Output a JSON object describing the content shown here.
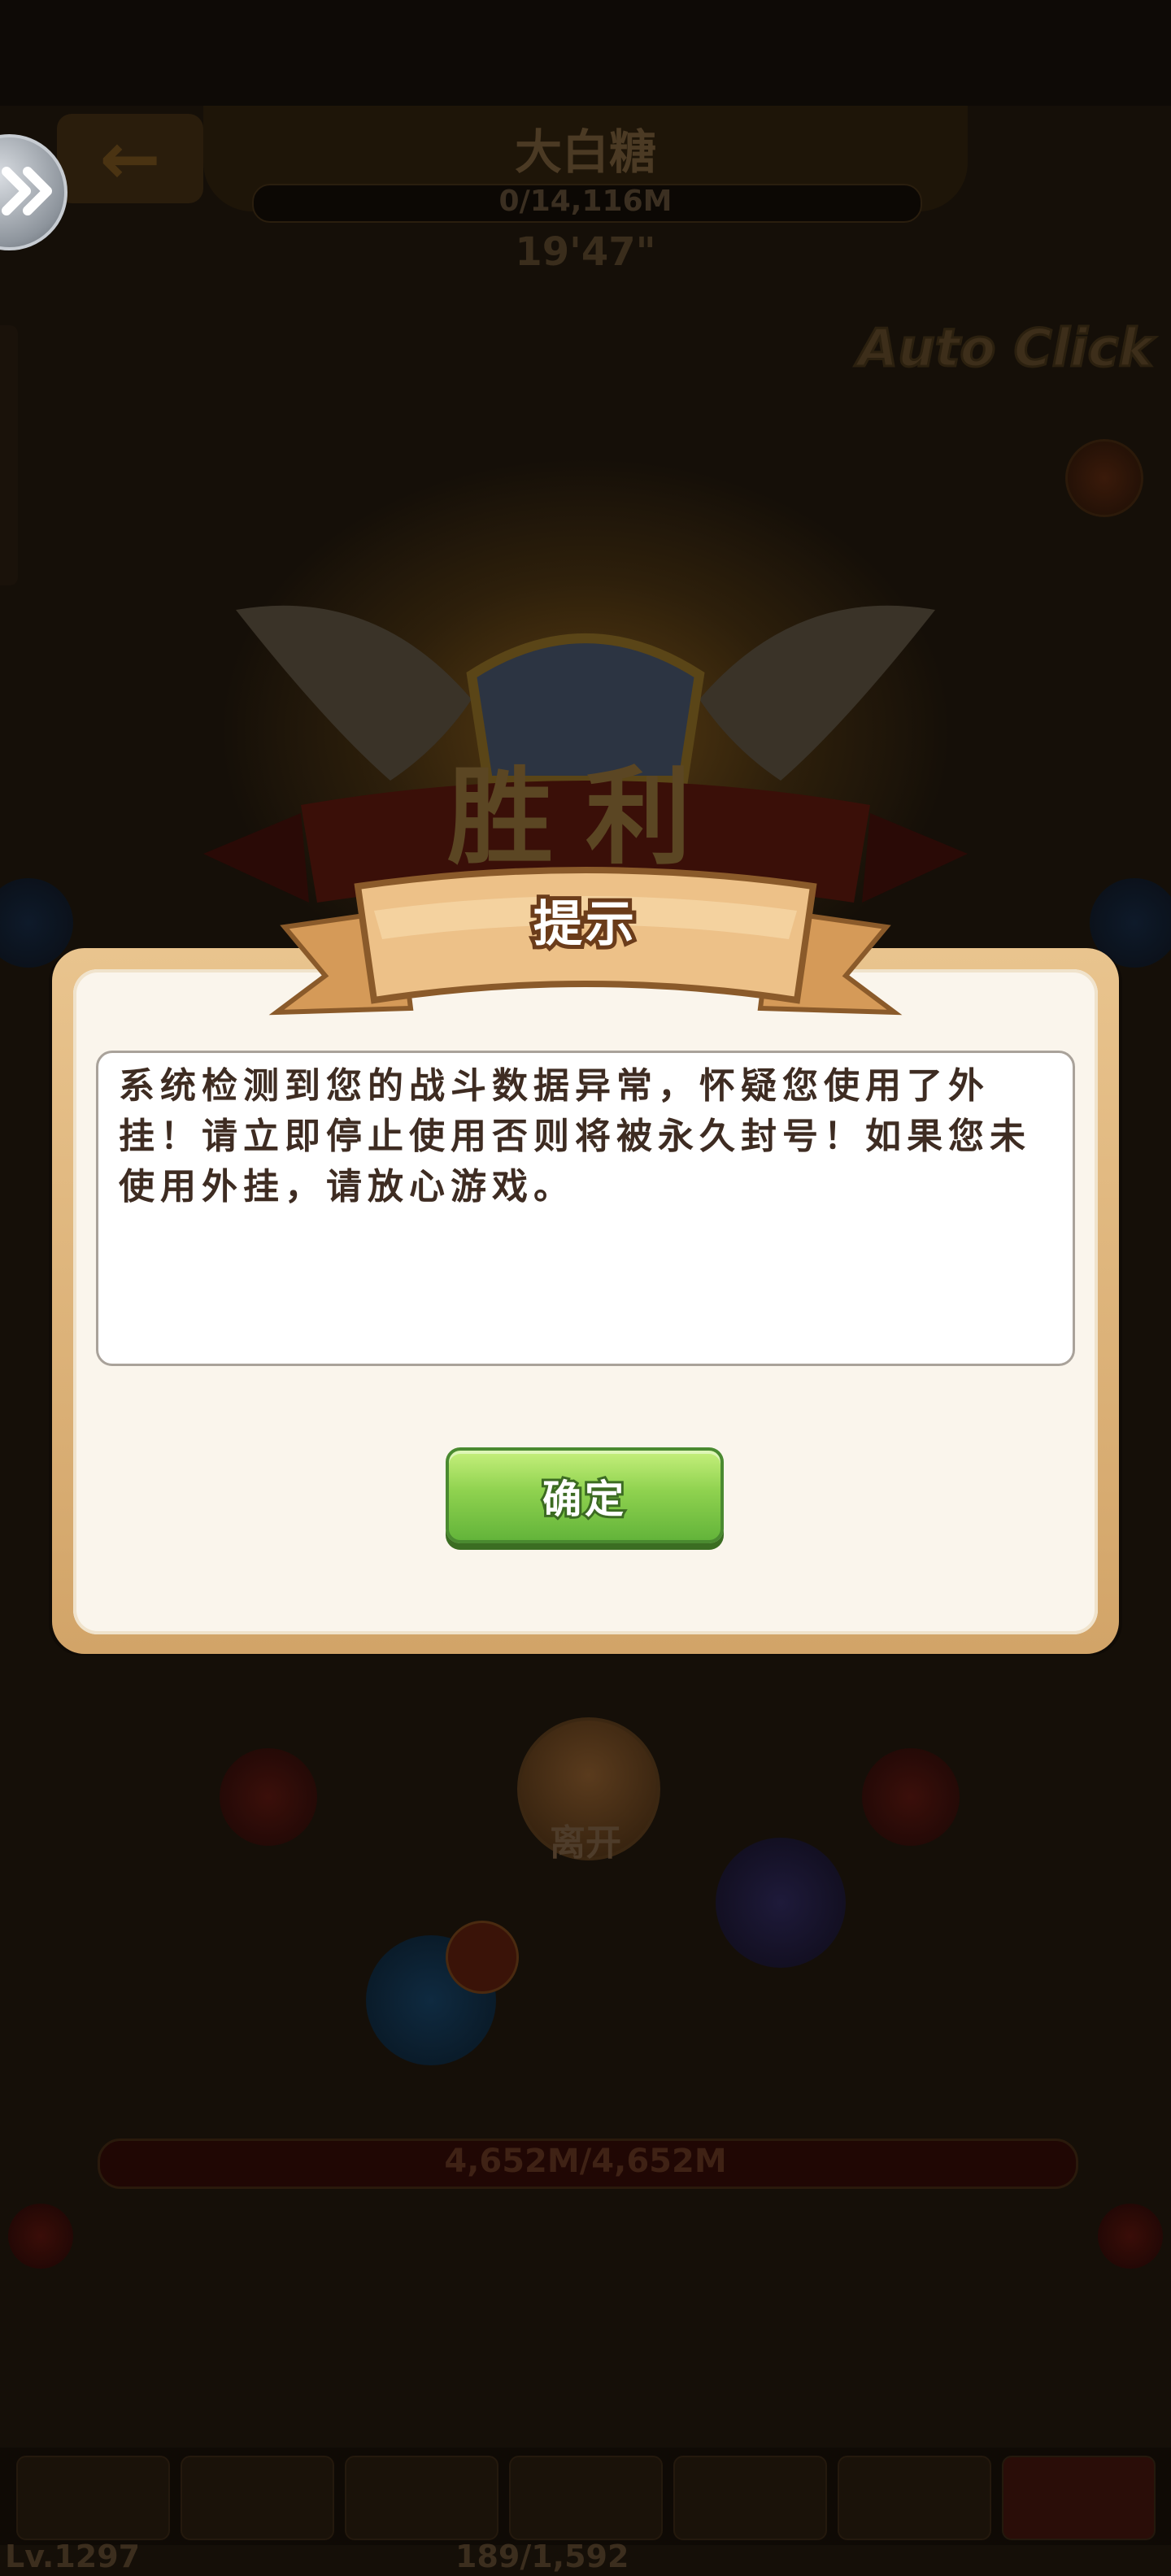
{
  "scene": {
    "stage_title": "大白糖",
    "hp_progress_text": "0/14,116M",
    "timer": "19'47\"",
    "auto_click": "Auto Click",
    "victory_text": "胜利",
    "leave_label": "离开",
    "bottom_hp_text": "4,652M/4,652M",
    "level_text": "Lv.1297",
    "energy_text": "189/1,592"
  },
  "dialog": {
    "title": "提示",
    "message": "系统检测到您的战斗数据异常，怀疑您使用了外挂！请立即停止使用否则将被永久封号！如果您未使用外挂，请放心游戏。",
    "confirm_label": "确定"
  },
  "colors": {
    "confirm_green": "#8fd24f",
    "frame_gold": "#d2a468",
    "ribbon": "#e8b877",
    "text_brown": "#3e2c22"
  }
}
